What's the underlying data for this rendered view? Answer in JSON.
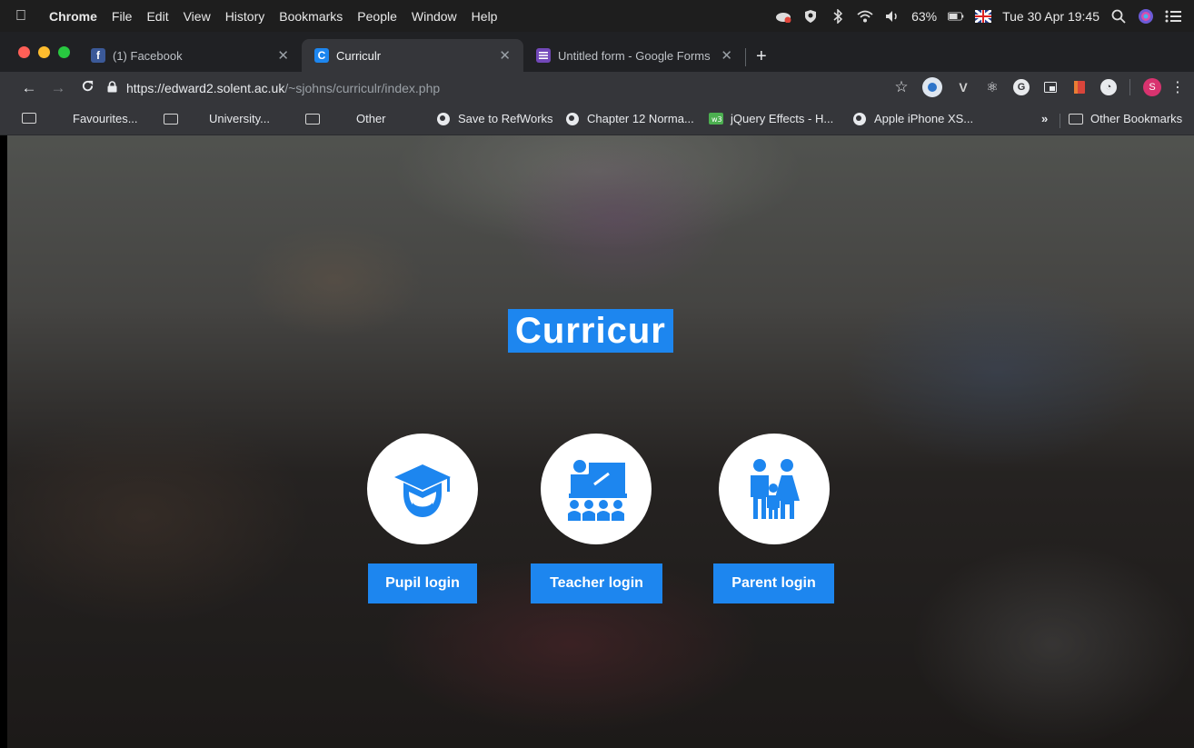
{
  "menubar": {
    "app_name": "Chrome",
    "items": [
      "File",
      "Edit",
      "View",
      "History",
      "Bookmarks",
      "People",
      "Window",
      "Help"
    ],
    "battery": "63%",
    "datetime": "Tue 30 Apr 19:45"
  },
  "tabs": [
    {
      "title": "(1) Facebook",
      "icon": "facebook-icon",
      "color": "#3b5998"
    },
    {
      "title": "Curriculr",
      "icon": "curriculr-icon",
      "color": "#1d86ef"
    },
    {
      "title": "Untitled form - Google Forms",
      "icon": "google-forms-icon",
      "color": "#7248b9"
    }
  ],
  "toolbar": {
    "url_host": "https://edward2.solent.ac.uk",
    "url_path": "/~sjohns/curriculr/index.php",
    "profile_initial": "S"
  },
  "bookmarks": [
    {
      "label": "Favourites...",
      "icon": "folder-icon"
    },
    {
      "label": "University...",
      "icon": "folder-icon"
    },
    {
      "label": "Other",
      "icon": "folder-icon"
    },
    {
      "label": "Save to RefWorks",
      "icon": "globe-icon"
    },
    {
      "label": "Chapter 12 Norma...",
      "icon": "globe-icon"
    },
    {
      "label": "jQuery Effects - H...",
      "icon": "w3-icon"
    },
    {
      "label": "Apple iPhone XS...",
      "icon": "globe-icon"
    }
  ],
  "bookmarks_more": "»",
  "other_bookmarks": "Other Bookmarks",
  "page": {
    "brand": "Curricur",
    "logins": [
      {
        "label": "Pupil login",
        "icon": "graduate-icon"
      },
      {
        "label": "Teacher login",
        "icon": "teacher-icon"
      },
      {
        "label": "Parent login",
        "icon": "family-icon"
      }
    ]
  },
  "colors": {
    "accent": "#1d86ef",
    "chrome_dark": "#202124",
    "chrome_toolbar": "#35363a"
  }
}
